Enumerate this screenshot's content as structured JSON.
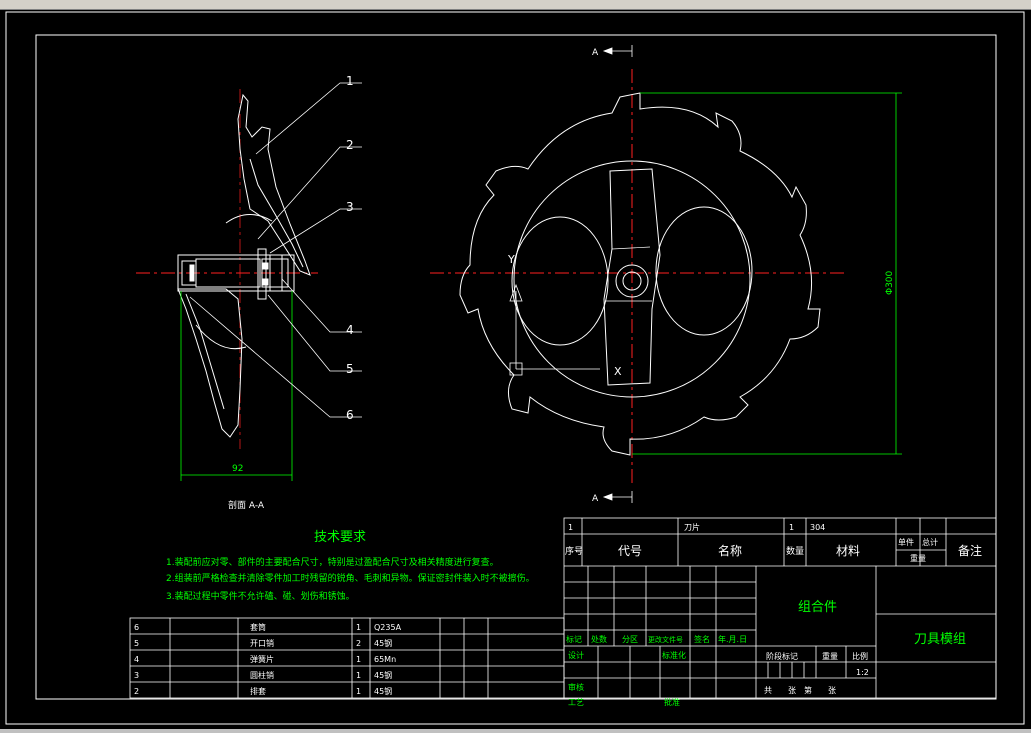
{
  "section_label": "A",
  "callouts": [
    "1",
    "2",
    "3",
    "4",
    "5",
    "6"
  ],
  "dimensions": {
    "width": "92",
    "diameter": "Φ300"
  },
  "section_view_label": "剖面 A-A",
  "axis_labels": {
    "x": "X",
    "y": "Y"
  },
  "tech_requirements": {
    "title": "技术要求",
    "items": [
      "1.装配前应对零、部件的主要配合尺寸，特别是过盈配合尺寸及相关精度进行复查。",
      "2.组装前严格检查并清除零件加工时残留的锐角、毛刺和异物。保证密封件装入时不被擦伤。",
      "3.装配过程中零件不允许磕、碰、划伤和锈蚀。"
    ]
  },
  "parts_list": [
    {
      "no": "6",
      "name": "套筒",
      "qty": "1",
      "material": "Q235A"
    },
    {
      "no": "5",
      "name": "开口销",
      "qty": "2",
      "material": "45钢"
    },
    {
      "no": "4",
      "name": "弹簧片",
      "qty": "1",
      "material": "65Mn"
    },
    {
      "no": "3",
      "name": "圆柱销",
      "qty": "1",
      "material": "45钢"
    },
    {
      "no": "2",
      "name": "排套",
      "qty": "1",
      "material": "45钢"
    }
  ],
  "title_block": {
    "row1": {
      "no": "1",
      "name": "刀片",
      "qty": "1",
      "material": "304"
    },
    "header": {
      "no": "序号",
      "code": "代号",
      "name": "名称",
      "qty": "数量",
      "material": "材料",
      "single": "单件",
      "total": "总计",
      "weight": "重量",
      "remark": "备注"
    },
    "assembly": "组合件",
    "drawing_name": "刀具模组",
    "labels": {
      "mark": "标记",
      "count": "处数",
      "zone": "分区",
      "doc_no": "更改文件号",
      "sign": "签名",
      "date": "年.月.日",
      "design": "设计",
      "standard": "标准化",
      "review": "审核",
      "process": "工艺",
      "approve": "批准",
      "stage": "阶段标记",
      "mass": "重量",
      "scale": "比例",
      "scale_value": "1:2",
      "sheets": "共　　张　第　　张"
    }
  },
  "colors": {
    "line": "#ffffff",
    "center": "#ff2020",
    "dim": "#00ff00",
    "text": "#ffff00",
    "cn": "#00ff00",
    "bg": "#000000"
  }
}
